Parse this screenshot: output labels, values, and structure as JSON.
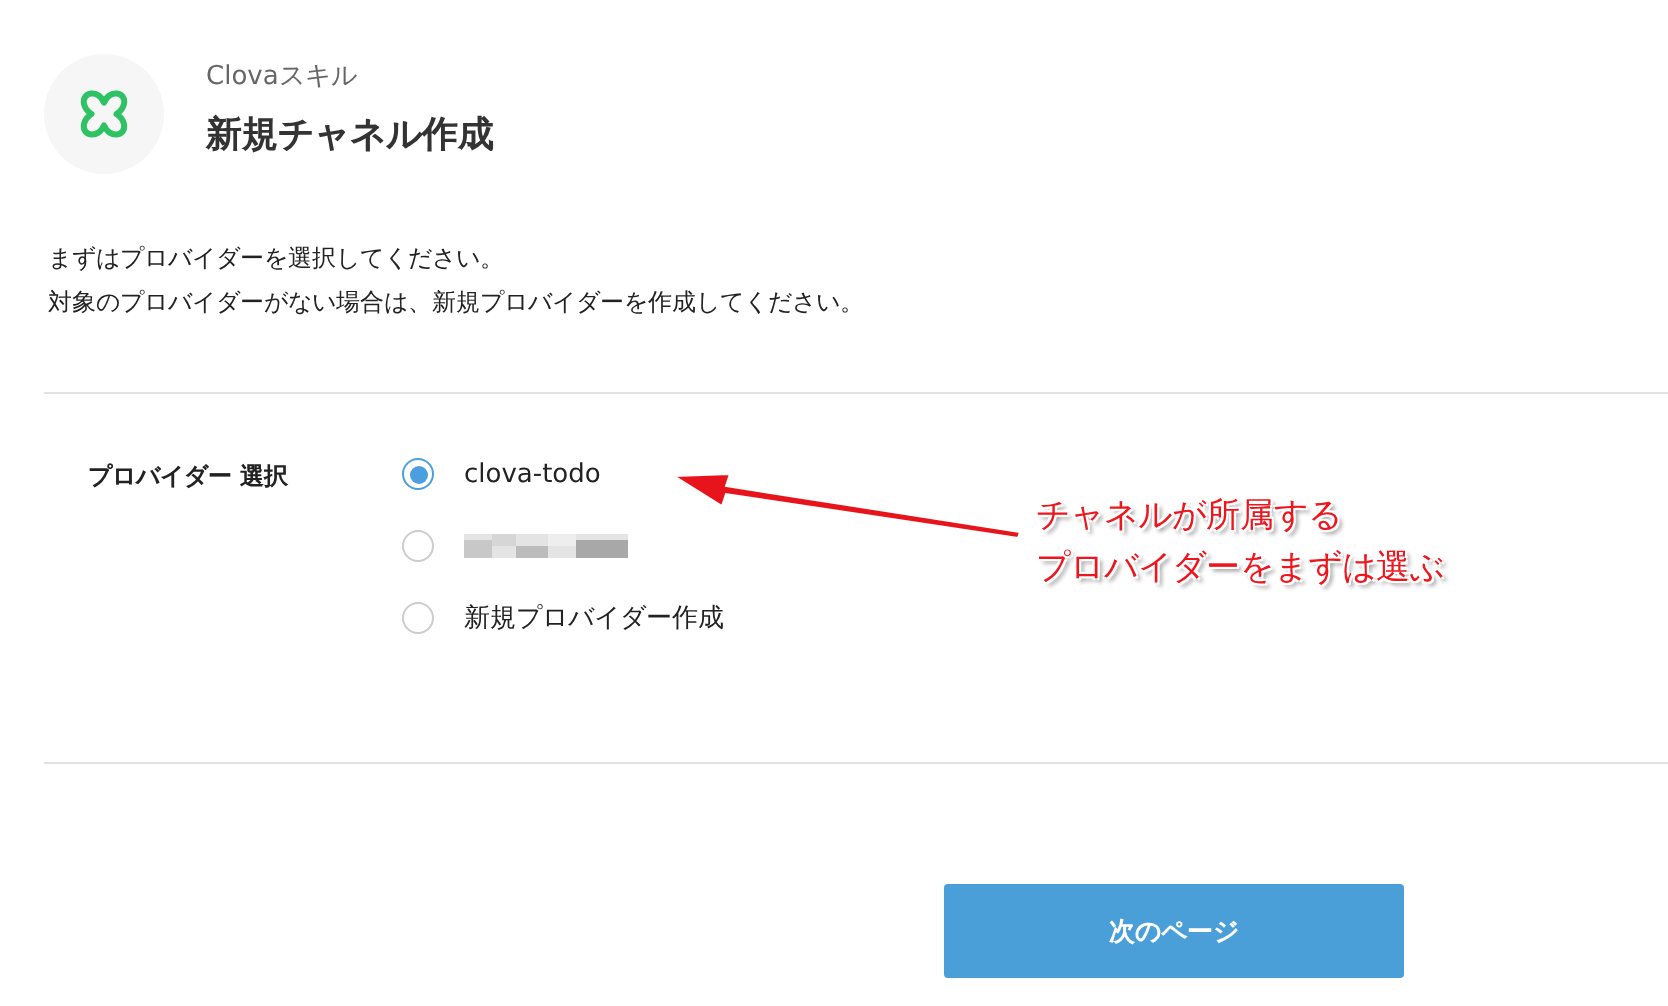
{
  "header": {
    "subtitle": "Clovaスキル",
    "title": "新規チャネル作成"
  },
  "intro": [
    "まずはプロバイダーを選択してください。",
    "対象のプロバイダーがない場合は、新規プロバイダーを作成してください。"
  ],
  "form": {
    "label": "プロバイダー 選択",
    "options": [
      {
        "kind": "text",
        "label": "clova-todo",
        "selected": true
      },
      {
        "kind": "redacted",
        "selected": false
      },
      {
        "kind": "text",
        "label": "新規プロバイダー作成",
        "selected": false
      }
    ]
  },
  "annotation": {
    "lines": [
      "チャネルが所属する",
      "プロバイダーをまずは選ぶ"
    ]
  },
  "next_button": "次のページ"
}
